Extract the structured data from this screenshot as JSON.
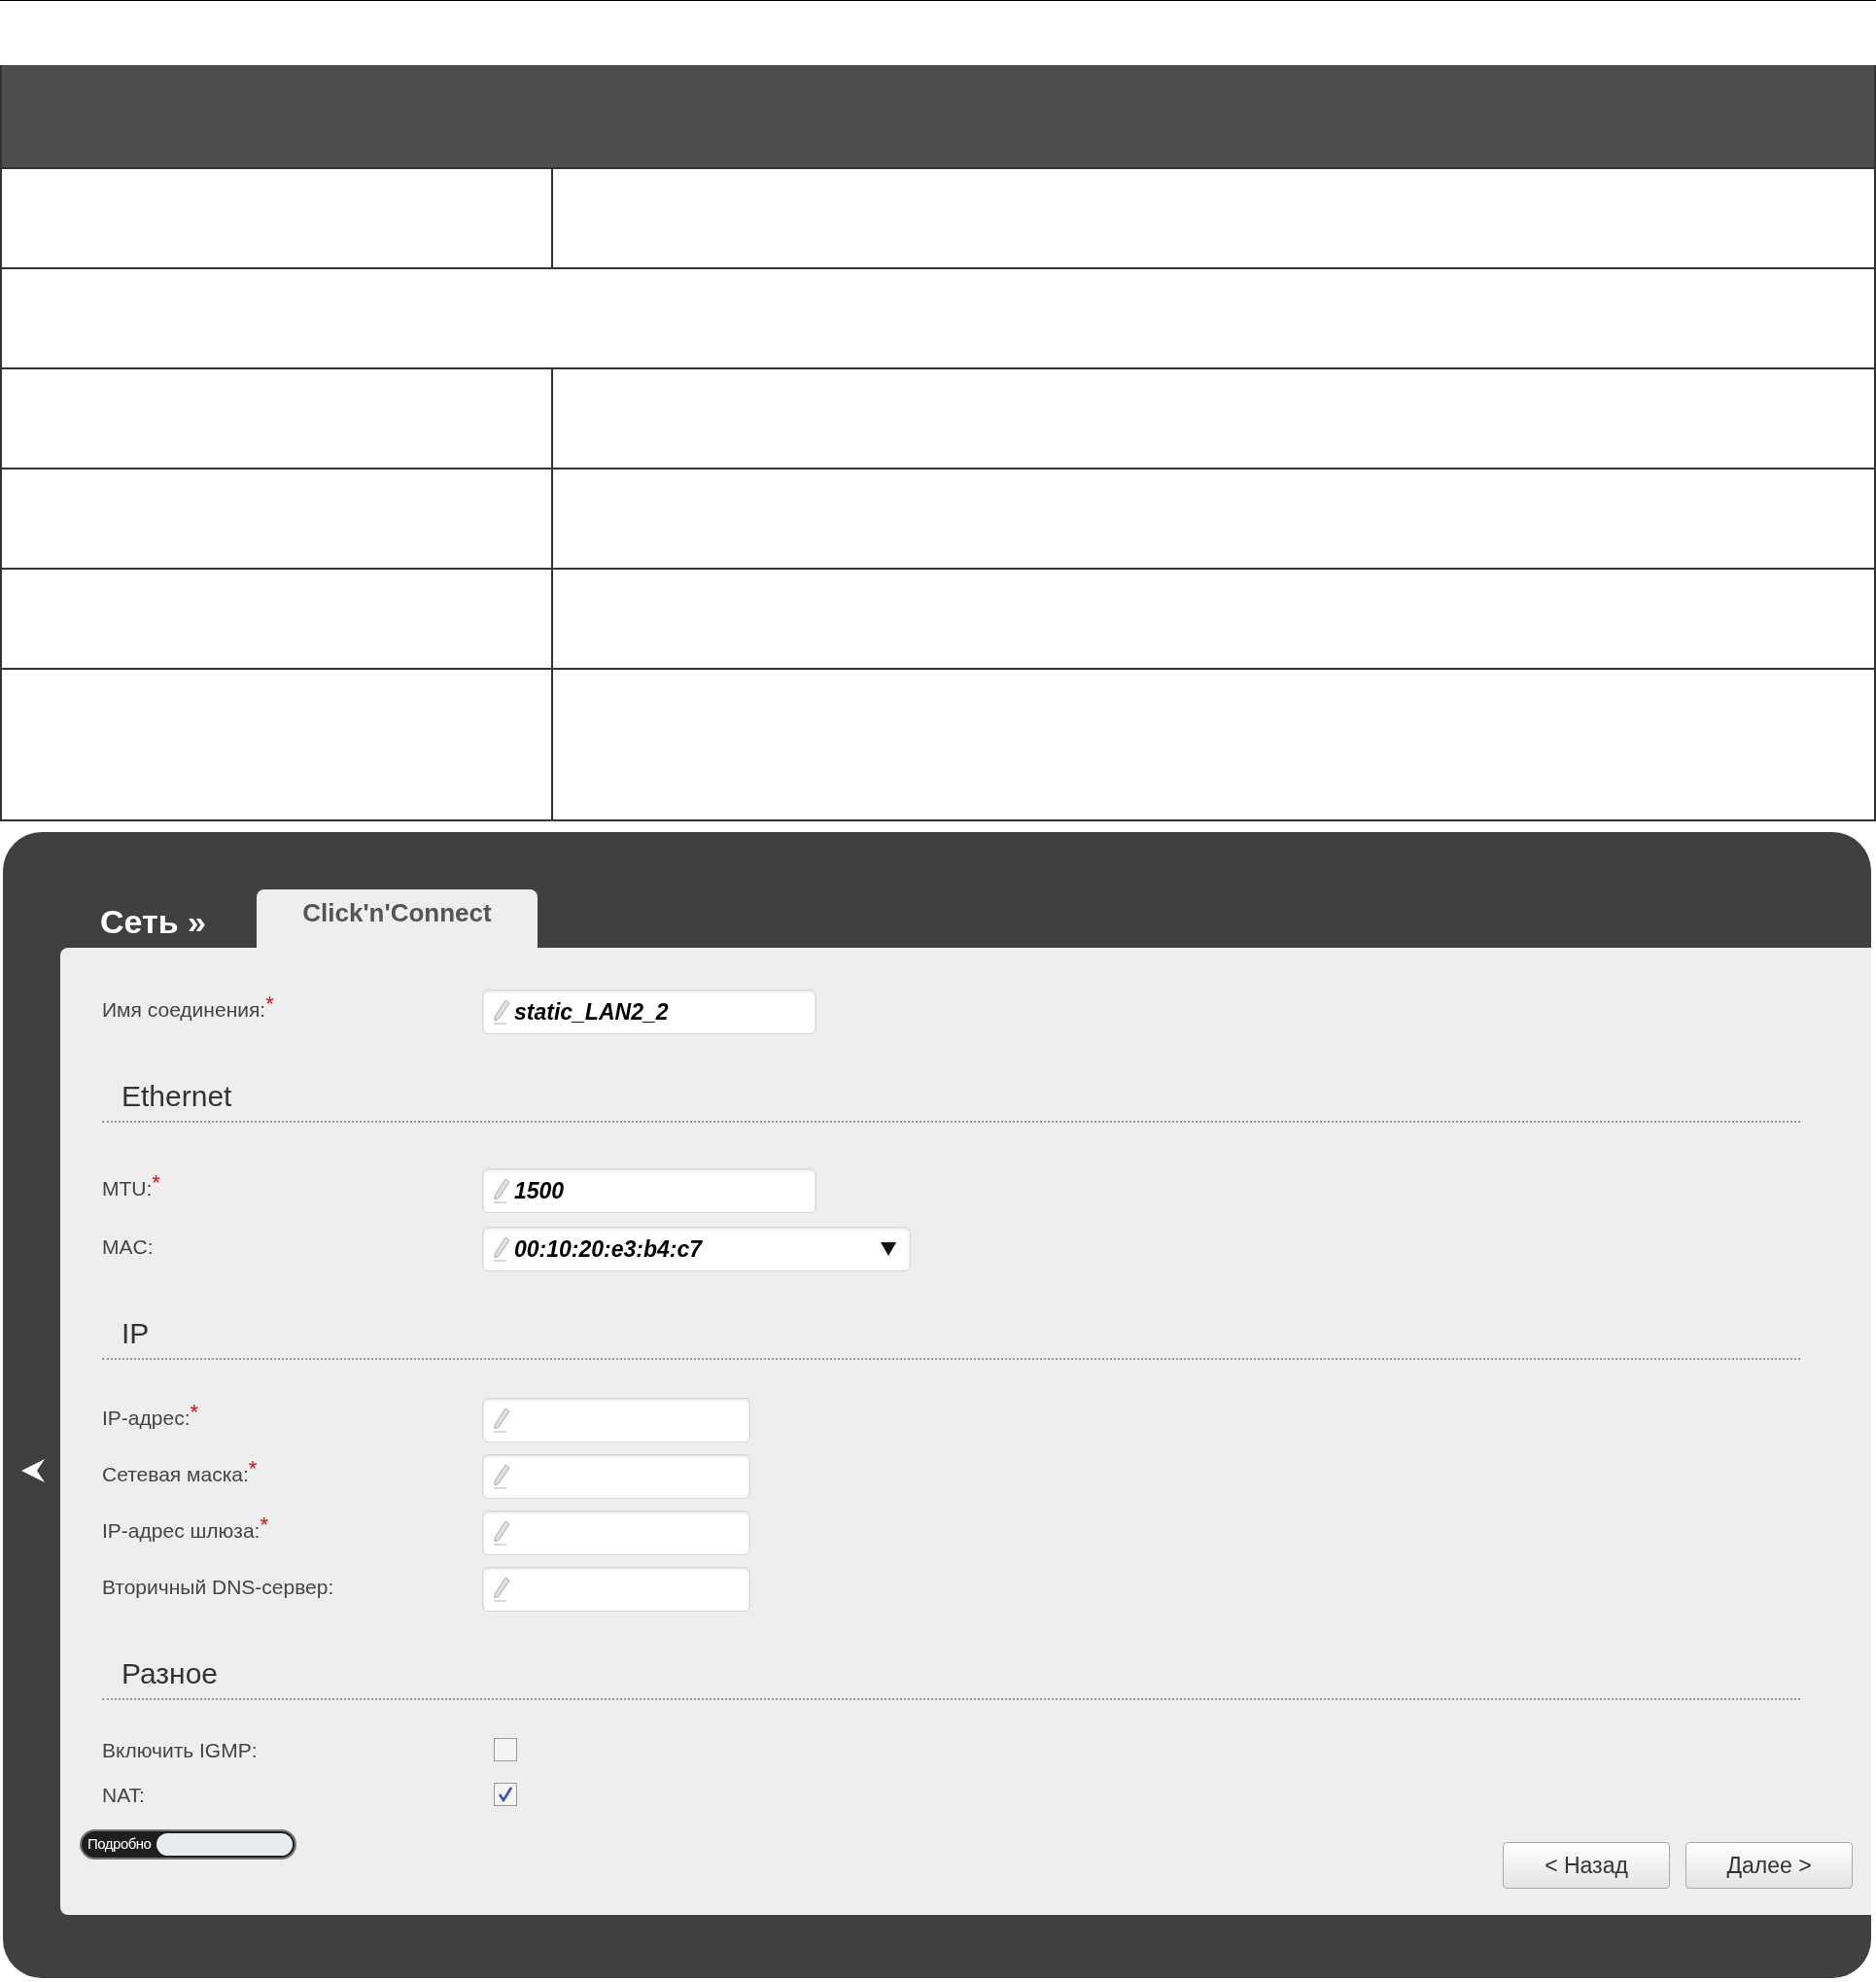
{
  "doc_table": {
    "rows": [
      {
        "kind": "split"
      },
      {
        "kind": "full"
      },
      {
        "kind": "split"
      },
      {
        "kind": "split"
      },
      {
        "kind": "split"
      },
      {
        "kind": "tall_split"
      }
    ]
  },
  "router": {
    "breadcrumb": "Сеть »",
    "tabs": [
      {
        "label": "Click'n'Connect",
        "selected": true
      }
    ],
    "required_mark": "*",
    "connection_name": {
      "label": "Имя соединения:",
      "required": true,
      "value": "static_LAN2_2"
    },
    "sections": [
      {
        "title": "Ethernet",
        "fields": [
          {
            "kind": "text",
            "label": "MTU:",
            "required": true,
            "value": "1500"
          },
          {
            "kind": "select",
            "label": "MAC:",
            "required": false,
            "value": "00:10:20:e3:b4:c7"
          }
        ]
      },
      {
        "title": "IP",
        "fields": [
          {
            "kind": "short",
            "label": "IP-адрес:",
            "required": true
          },
          {
            "kind": "short",
            "label": "Сетевая маска:",
            "required": true
          },
          {
            "kind": "short",
            "label": "IP-адрес шлюза:",
            "required": true
          },
          {
            "kind": "short",
            "label": "Вторичный DNS-сервер:",
            "required": false
          }
        ]
      },
      {
        "title": "Разное",
        "fields": [
          {
            "kind": "checkbox",
            "label": "Включить IGMP:",
            "checked": false
          },
          {
            "kind": "checkbox",
            "label": "NAT:",
            "checked": true
          }
        ]
      }
    ],
    "details_toggle": {
      "label": "Подробно",
      "on": false
    },
    "buttons": [
      "< Назад",
      "Далее >"
    ]
  }
}
